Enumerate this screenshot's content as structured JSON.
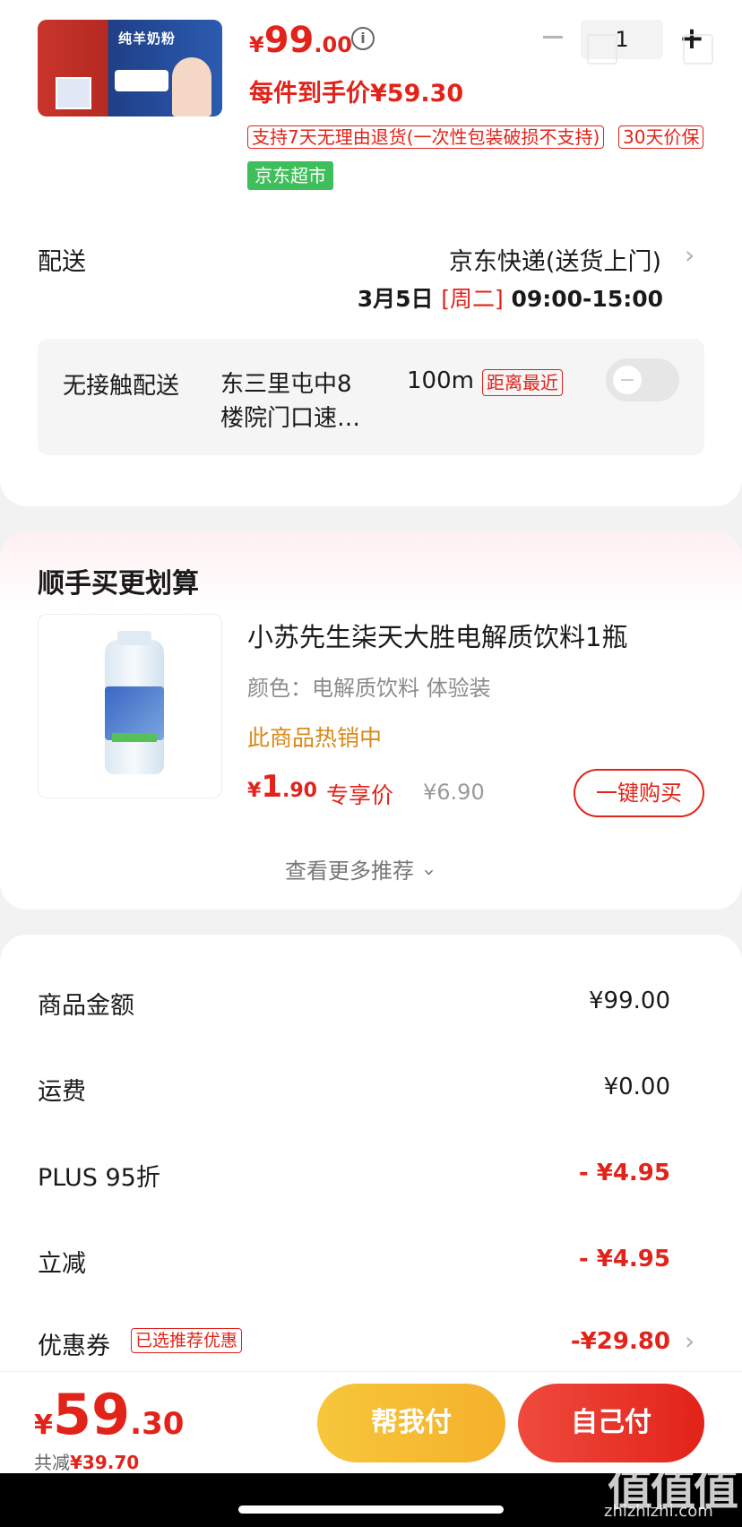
{
  "product": {
    "thumb_title": "纯羊奶粉",
    "price_symbol": "¥",
    "price_int": "99",
    "price_dec": ".00",
    "quantity": "1",
    "unit_price": "每件到手价¥59.30",
    "tag_return": "支持7天无理由退货(一次性包装破损不支持)",
    "tag_price_protect": "30天价保",
    "tag_store": "京东超市"
  },
  "delivery": {
    "label": "配送",
    "method": "京东快递(送货上门)",
    "date": "3月5日",
    "weekday": "[周二]",
    "time": "09:00-15:00"
  },
  "contactless": {
    "label": "无接触配送",
    "location_line1": "东三里屯中8",
    "location_line2": "楼院门口速…",
    "distance": "100m",
    "badge": "距离最近"
  },
  "recommend": {
    "section_title": "顺手买更划算",
    "item_title": "小苏先生柒天大胜电解质饮料1瓶",
    "item_spec": "颜色：电解质饮料 体验装",
    "item_hot": "此商品热销中",
    "price_symbol": "¥",
    "price_int": "1",
    "price_dec": ".90",
    "exclusive_label": "专享价",
    "orig_price": "¥6.90",
    "buy_button": "一键购买",
    "more": "查看更多推荐"
  },
  "summary": {
    "rows": [
      {
        "label": "商品金额",
        "value": "¥99.00"
      },
      {
        "label": "运费",
        "value": "¥0.00"
      },
      {
        "label": "PLUS 95折",
        "value": "- ¥4.95"
      },
      {
        "label": "立减",
        "value": "- ¥4.95"
      },
      {
        "label": "优惠券",
        "value": "-¥29.80"
      }
    ],
    "coupon_tag": "已选推荐优惠"
  },
  "bottom": {
    "total_symbol": "¥",
    "total_int": "59",
    "total_dec": ".30",
    "saved_label": "共减",
    "saved_value": "¥39.70",
    "help_pay": "帮我付",
    "self_pay": "自己付"
  },
  "watermark": {
    "text": "值值值",
    "url": "zhizhizhi.com"
  },
  "colors": {
    "accent_red": "#e2231a",
    "store_green": "#3fbf5c",
    "help_yellow": "#f5b12c"
  },
  "icons": [
    "info-icon",
    "minus-icon",
    "plus-icon",
    "chevron-right-icon",
    "chevron-down-icon"
  ]
}
